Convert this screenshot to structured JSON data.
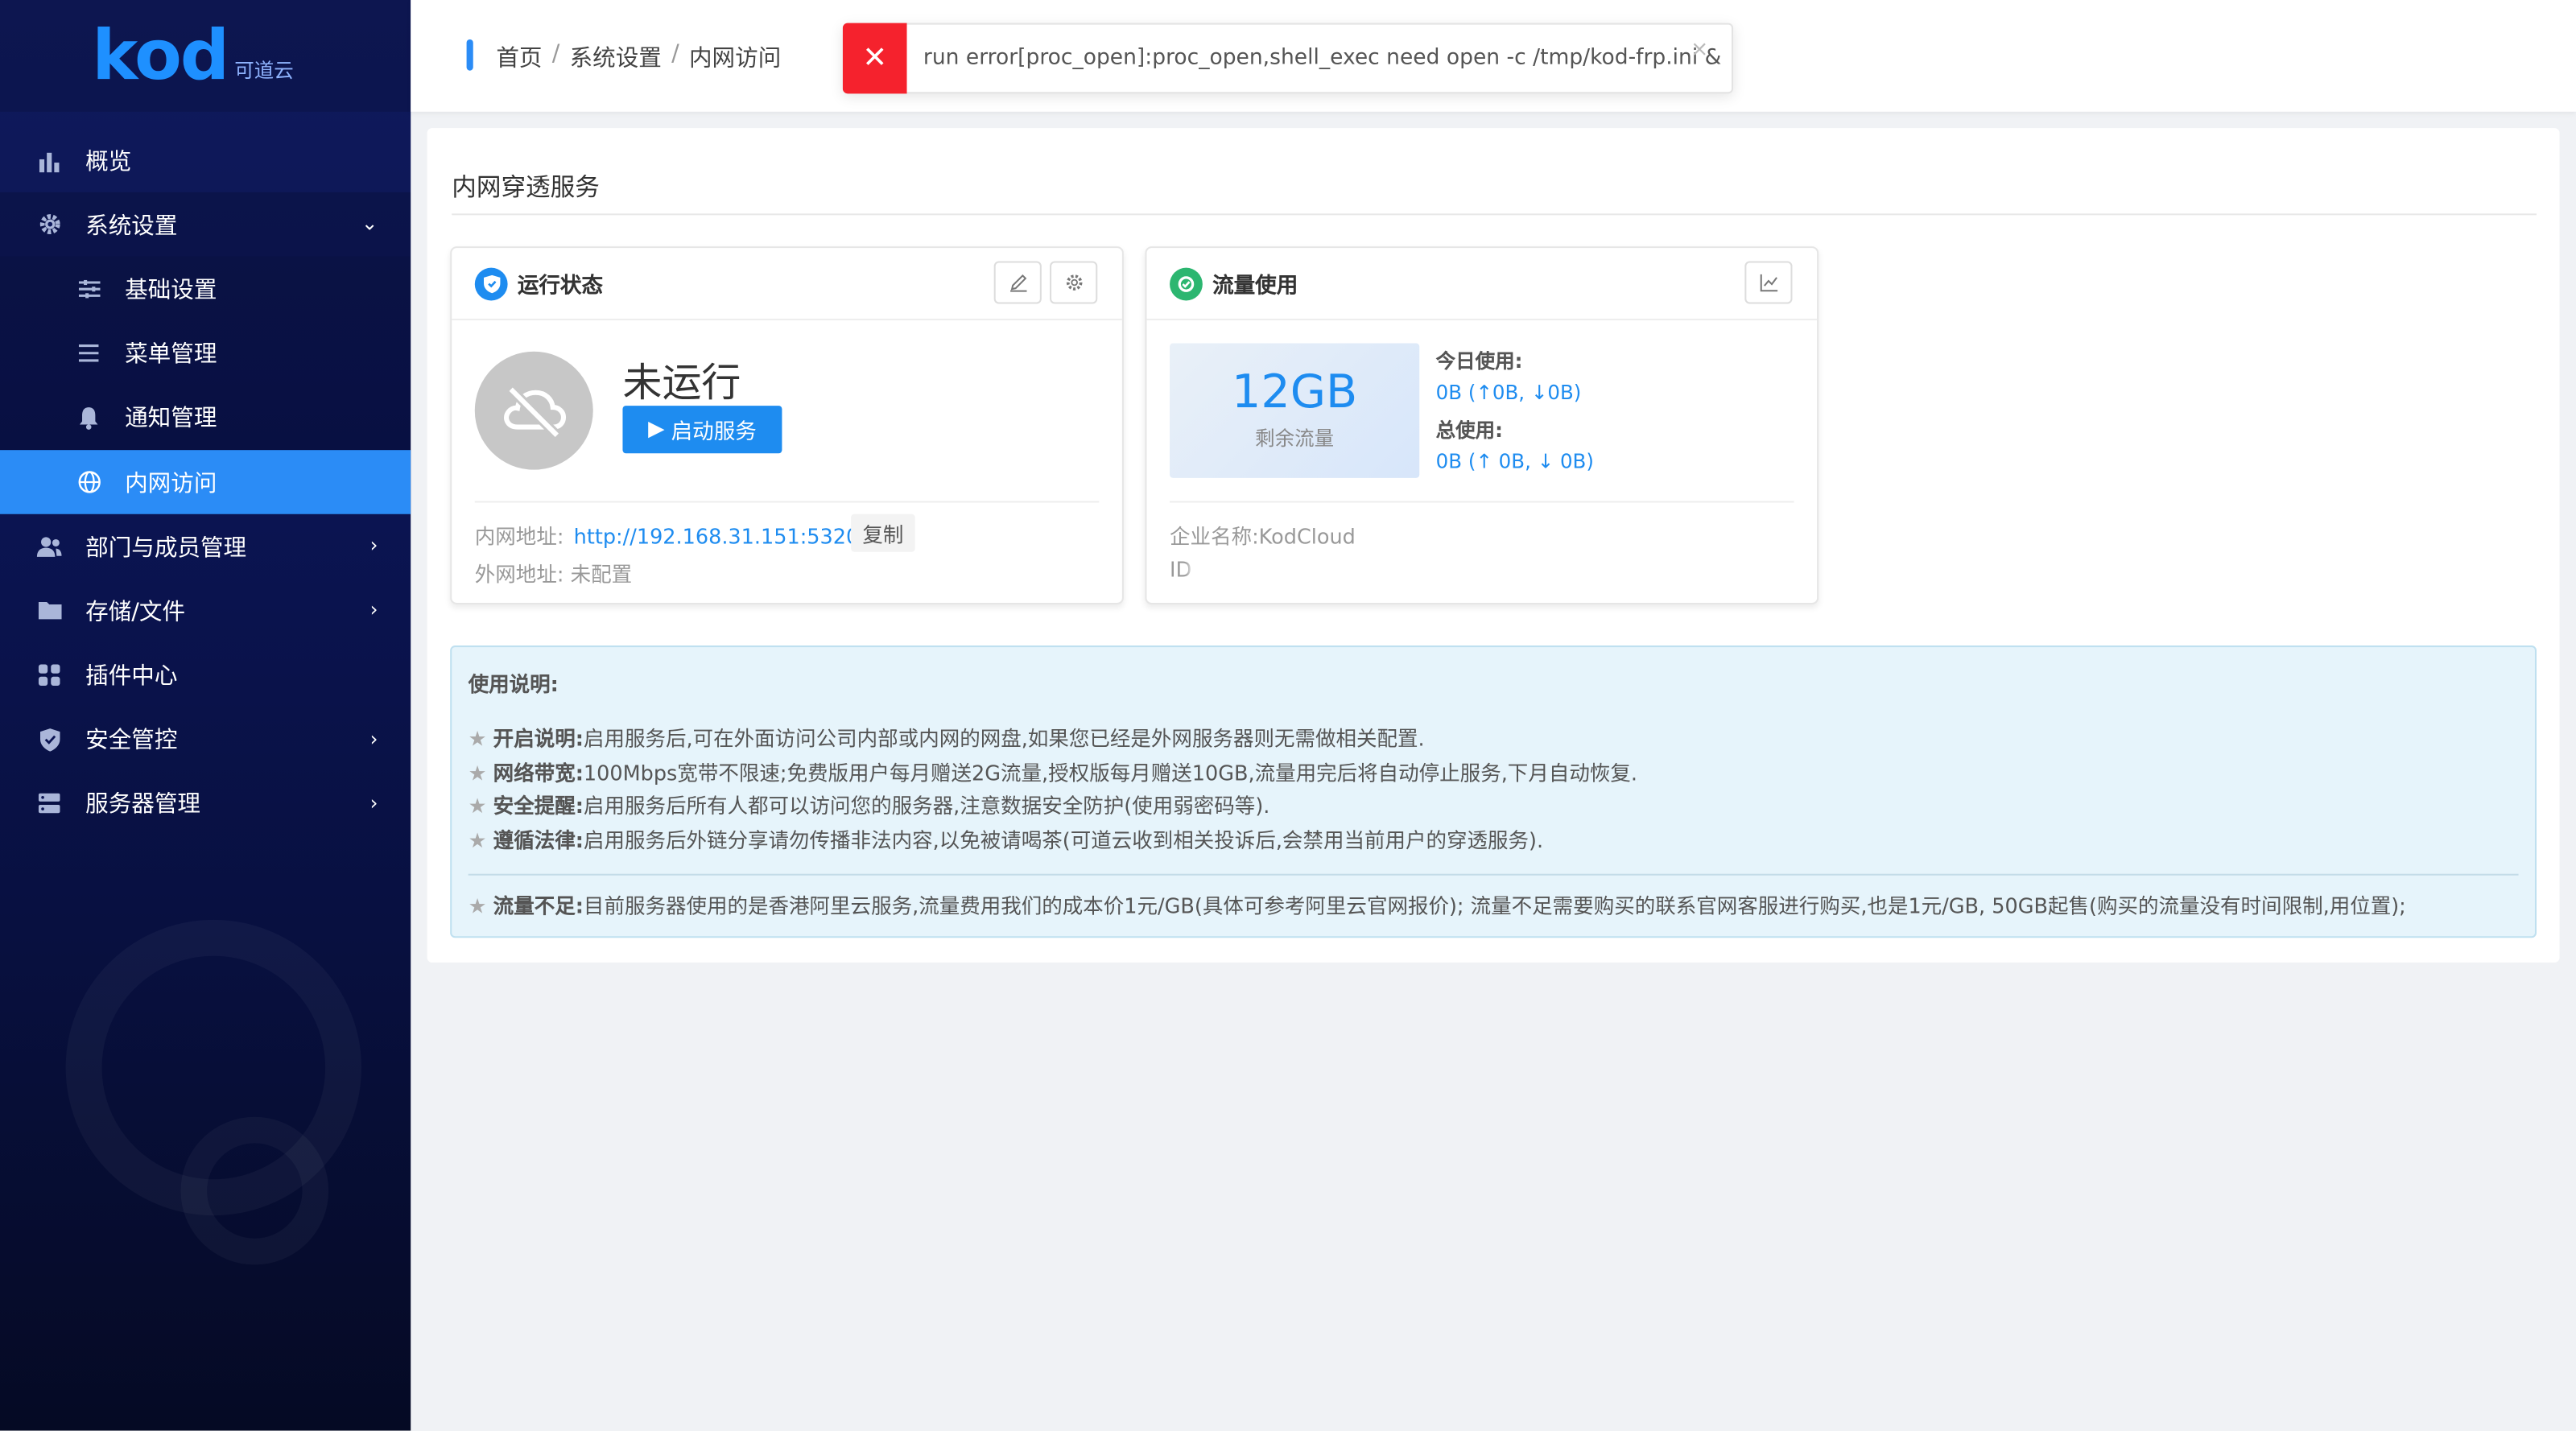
{
  "sidebar": {
    "logo_text": "kod",
    "logo_sub": "可道云",
    "items": [
      {
        "label": "概览",
        "icon": "bar-chart-icon"
      },
      {
        "label": "系统设置",
        "icon": "gear-icon"
      },
      {
        "label": "基础设置",
        "icon": "sliders-icon"
      },
      {
        "label": "菜单管理",
        "icon": "list-icon"
      },
      {
        "label": "通知管理",
        "icon": "bell-icon"
      },
      {
        "label": "内网访问",
        "icon": "globe-icon"
      },
      {
        "label": "部门与成员管理",
        "icon": "users-icon"
      },
      {
        "label": "存储/文件",
        "icon": "folder-icon"
      },
      {
        "label": "插件中心",
        "icon": "grid-icon"
      },
      {
        "label": "安全管控",
        "icon": "shield-icon"
      },
      {
        "label": "服务器管理",
        "icon": "server-icon"
      }
    ]
  },
  "breadcrumb": [
    "首页",
    "系统设置",
    "内网访问"
  ],
  "toast": {
    "message": "run error[proc_open]:proc_open,shell_exec need open -c /tmp/kod-frp.ini &",
    "close": "×"
  },
  "main": {
    "title": "内网穿透服务",
    "status_card": {
      "title": "运行状态",
      "status": "未运行",
      "start_button": "启动服务",
      "intranet_label": "内网地址:",
      "intranet_url": "http://192.168.31.151:5320/",
      "copy_button": "复制",
      "extranet_label": "外网地址:",
      "extranet_value": "未配置"
    },
    "flow_card": {
      "title": "流量使用",
      "remaining_value": "12GB",
      "remaining_label": "剩余流量",
      "today_label": "今日使用:",
      "today_value": "0B (↑0B, ↓0B)",
      "total_label": "总使用:",
      "total_value": "0B (↑ 0B, ↓ 0B)",
      "company": "企业名称:KodCloud",
      "id_prefix": "ID"
    },
    "info": {
      "title": "使用说明:",
      "lines": [
        {
          "key": "开启说明:",
          "text": "启用服务后,可在外面访问公司内部或内网的网盘,如果您已经是外网服务器则无需做相关配置."
        },
        {
          "key": "网络带宽:",
          "text": "100Mbps宽带不限速;免费版用户每月赠送2G流量,授权版每月赠送10GB,流量用完后将自动停止服务,下月自动恢复."
        },
        {
          "key": "安全提醒:",
          "text": "启用服务后所有人都可以访问您的服务器,注意数据安全防护(使用弱密码等)."
        },
        {
          "key": "遵循法律:",
          "text": "启用服务后外链分享请勿传播非法内容,以免被请喝茶(可道云收到相关投诉后,会禁用当前用户的穿透服务)."
        }
      ],
      "extra": {
        "key": "流量不足:",
        "text": "目前服务器使用的是香港阿里云服务,流量费用我们的成本价1元/GB(具体可参考阿里云官网报价); 流量不足需要购买的联系官网客服进行购买,也是1元/GB, 50GB起售(购买的流量没有时间限制,用位置);"
      }
    }
  },
  "colors": {
    "accent": "#2b8cf6",
    "error": "#f5222d",
    "sidebar": "#0b1452"
  }
}
